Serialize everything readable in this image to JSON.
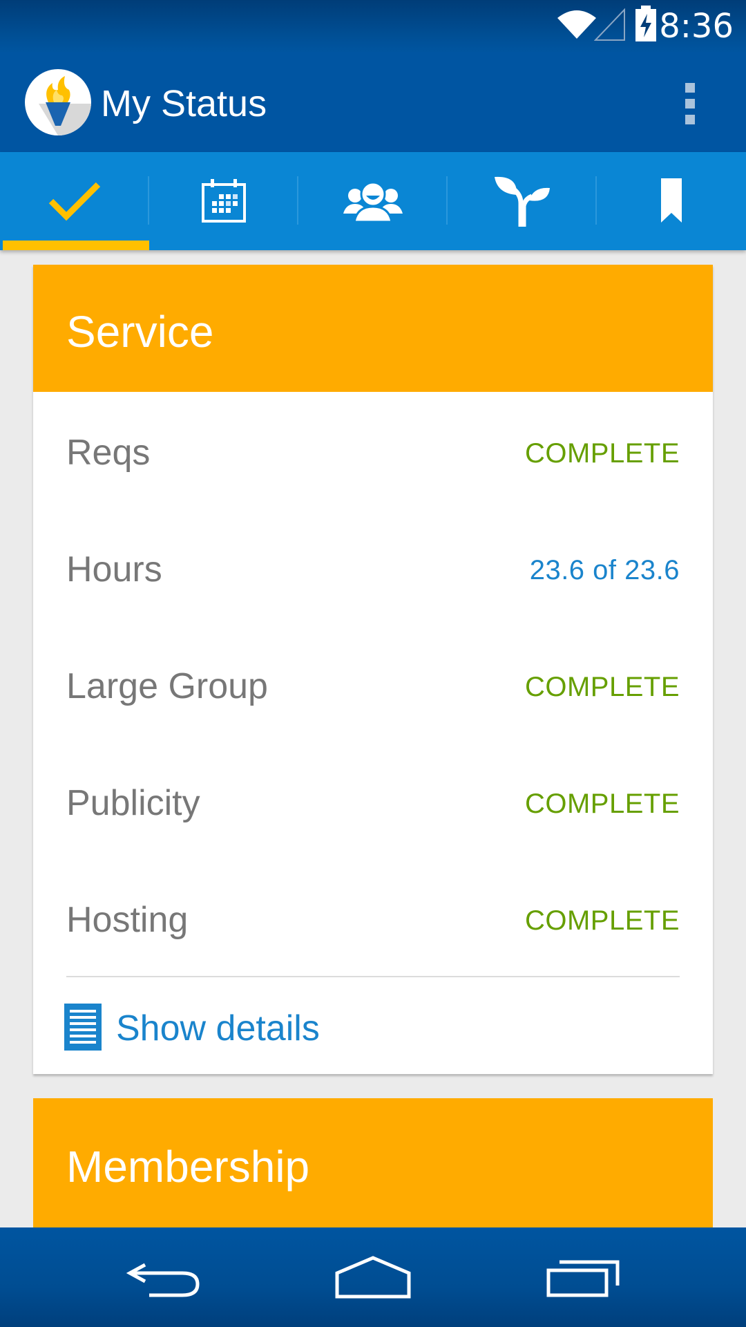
{
  "status_bar": {
    "time": "8:36"
  },
  "app_bar": {
    "title": "My Status"
  },
  "tabs": [
    {
      "name": "status",
      "icon": "check-icon",
      "selected": true
    },
    {
      "name": "calendar",
      "icon": "calendar-icon",
      "selected": false
    },
    {
      "name": "members",
      "icon": "group-icon",
      "selected": false
    },
    {
      "name": "growth",
      "icon": "sprout-icon",
      "selected": false
    },
    {
      "name": "bookmarks",
      "icon": "bookmark-icon",
      "selected": false
    }
  ],
  "service": {
    "title": "Service",
    "rows": [
      {
        "label": "Reqs",
        "value": "COMPLETE"
      },
      {
        "label": "Hours",
        "value": "23.6 of 23.6"
      },
      {
        "label": "Large Group",
        "value": "COMPLETE"
      },
      {
        "label": "Publicity",
        "value": "COMPLETE"
      },
      {
        "label": "Hosting",
        "value": "COMPLETE"
      }
    ],
    "details_label": "Show details"
  },
  "membership": {
    "title": "Membership"
  },
  "colors": {
    "app_bar": "#0055a2",
    "tab_bar": "#0a86d4",
    "accent": "#ffab00",
    "complete": "#669f00",
    "link": "#1a84cc"
  }
}
